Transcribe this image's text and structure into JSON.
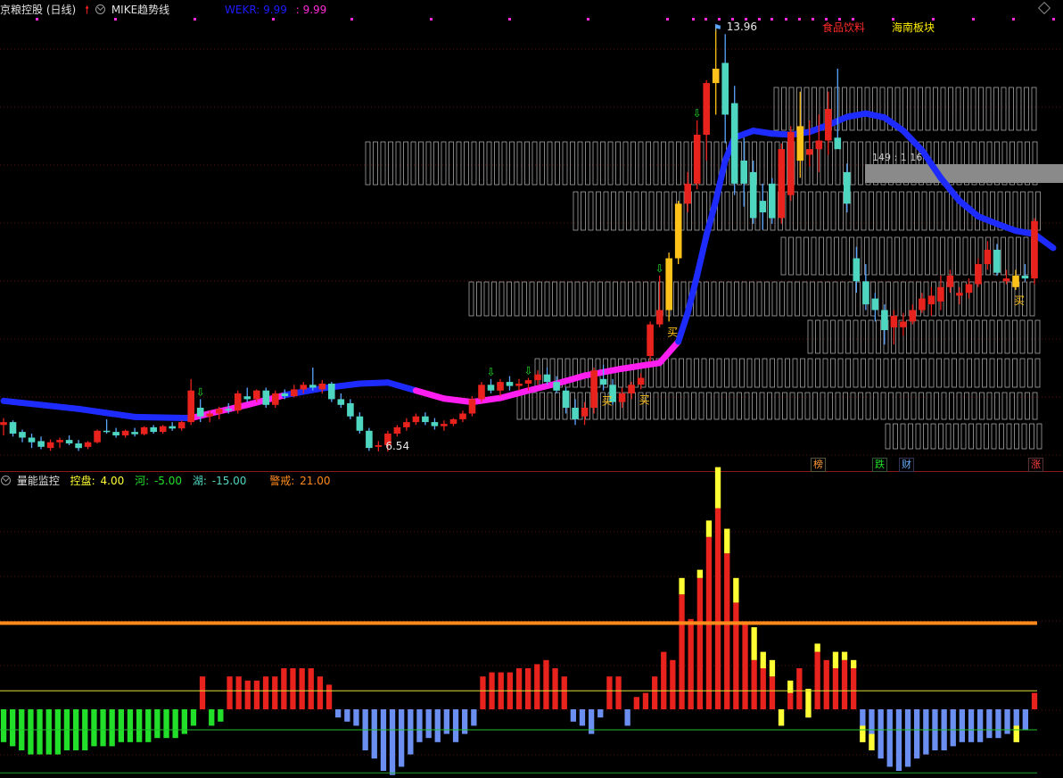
{
  "top_header": {
    "stock": "京粮控股 (日线)",
    "indicator": "MIKE趋势线",
    "wekr_label": "WEKR: 9.99",
    "wekr_value": ": 9.99"
  },
  "sector_tags": {
    "food": "食品饮料",
    "hainan": "海南板块"
  },
  "bottom_header": {
    "name": "量能监控",
    "kongpan_label": "控盘:",
    "kongpan_value": "4.00",
    "he_label": "河:",
    "he_value": "-5.00",
    "hu_label": "湖:",
    "hu_value": "-15.00",
    "jingjie_label": "警戒:",
    "jingjie_value": "21.00"
  },
  "badges": [
    "榜",
    "跌",
    "财",
    "涨"
  ],
  "colors": {
    "up": "#e8221c",
    "down": "#4fd6c1",
    "gold": "#ffc21a",
    "blue_line": "#1e2bff",
    "magenta_line": "#ff1ef0",
    "orange_line": "#ff8a1c",
    "green_bar": "#22e02a",
    "blue_bar": "#6b8ff0",
    "yellow_bar": "#ffff33"
  },
  "chart_data": [
    {
      "type": "candlestick",
      "title": "京粮控股 (日线)",
      "annotations": {
        "high": "13.96",
        "low": "6.54",
        "box_label": "149 : 1 16",
        "buy": "买"
      },
      "candles": [
        [
          7.0,
          7.12,
          6.82,
          7.05
        ],
        [
          7.05,
          7.08,
          6.8,
          6.85
        ],
        [
          6.88,
          6.92,
          6.7,
          6.78
        ],
        [
          6.78,
          6.85,
          6.6,
          6.7
        ],
        [
          6.72,
          6.8,
          6.58,
          6.62
        ],
        [
          6.6,
          6.75,
          6.55,
          6.7
        ],
        [
          6.7,
          6.78,
          6.6,
          6.74
        ],
        [
          6.74,
          6.82,
          6.65,
          6.68
        ],
        [
          6.68,
          6.74,
          6.55,
          6.6
        ],
        [
          6.62,
          6.72,
          6.58,
          6.7
        ],
        [
          6.7,
          6.92,
          6.68,
          6.9
        ],
        [
          6.9,
          7.1,
          6.85,
          6.88
        ],
        [
          6.88,
          6.95,
          6.78,
          6.82
        ],
        [
          6.82,
          6.92,
          6.78,
          6.9
        ],
        [
          6.88,
          6.95,
          6.8,
          6.84
        ],
        [
          6.84,
          6.98,
          6.82,
          6.96
        ],
        [
          6.96,
          7.0,
          6.85,
          6.88
        ],
        [
          6.88,
          7.0,
          6.85,
          6.98
        ],
        [
          6.98,
          7.05,
          6.9,
          6.94
        ],
        [
          6.94,
          7.08,
          6.9,
          7.05
        ],
        [
          7.05,
          7.8,
          7.0,
          7.6
        ],
        [
          7.3,
          7.45,
          7.05,
          7.15
        ],
        [
          7.15,
          7.25,
          7.05,
          7.2
        ],
        [
          7.2,
          7.32,
          7.1,
          7.28
        ],
        [
          7.28,
          7.38,
          7.2,
          7.25
        ],
        [
          7.25,
          7.6,
          7.2,
          7.55
        ],
        [
          7.5,
          7.65,
          7.4,
          7.45
        ],
        [
          7.45,
          7.62,
          7.4,
          7.6
        ],
        [
          7.6,
          7.65,
          7.3,
          7.35
        ],
        [
          7.35,
          7.6,
          7.3,
          7.55
        ],
        [
          7.55,
          7.62,
          7.45,
          7.5
        ],
        [
          7.5,
          7.7,
          7.48,
          7.62
        ],
        [
          7.62,
          7.75,
          7.55,
          7.7
        ],
        [
          7.7,
          8.0,
          7.6,
          7.65
        ],
        [
          7.62,
          7.78,
          7.55,
          7.72
        ],
        [
          7.72,
          7.75,
          7.4,
          7.45
        ],
        [
          7.45,
          7.55,
          7.3,
          7.35
        ],
        [
          7.38,
          7.45,
          7.1,
          7.15
        ],
        [
          7.15,
          7.22,
          6.85,
          6.9
        ],
        [
          6.9,
          6.95,
          6.55,
          6.6
        ],
        [
          6.62,
          6.72,
          6.54,
          6.65
        ],
        [
          6.65,
          6.9,
          6.54,
          6.85
        ],
        [
          6.85,
          7.0,
          6.8,
          6.96
        ],
        [
          6.96,
          7.12,
          6.9,
          7.05
        ],
        [
          7.05,
          7.2,
          7.0,
          7.15
        ],
        [
          7.15,
          7.22,
          7.0,
          7.05
        ],
        [
          7.05,
          7.12,
          6.92,
          6.98
        ],
        [
          6.98,
          7.08,
          6.9,
          7.02
        ],
        [
          7.02,
          7.12,
          6.98,
          7.1
        ],
        [
          7.1,
          7.25,
          7.05,
          7.2
        ],
        [
          7.2,
          7.5,
          7.15,
          7.45
        ],
        [
          7.45,
          7.75,
          7.4,
          7.7
        ],
        [
          7.7,
          7.8,
          7.55,
          7.6
        ],
        [
          7.6,
          7.8,
          7.5,
          7.75
        ],
        [
          7.75,
          7.85,
          7.6,
          7.68
        ],
        [
          7.68,
          7.8,
          7.6,
          7.72
        ],
        [
          7.72,
          7.82,
          7.6,
          7.78
        ],
        [
          7.78,
          7.95,
          7.7,
          7.88
        ],
        [
          7.88,
          8.0,
          7.7,
          7.75
        ],
        [
          7.75,
          7.85,
          7.55,
          7.6
        ],
        [
          7.6,
          7.65,
          7.2,
          7.3
        ],
        [
          7.3,
          7.45,
          7.0,
          7.1
        ],
        [
          7.15,
          7.4,
          7.0,
          7.3
        ],
        [
          7.3,
          8.0,
          7.2,
          7.95
        ],
        [
          7.8,
          8.05,
          7.6,
          7.7
        ],
        [
          7.7,
          7.8,
          7.35,
          7.4
        ],
        [
          7.4,
          7.65,
          7.3,
          7.55
        ],
        [
          7.55,
          7.75,
          7.45,
          7.7
        ],
        [
          7.7,
          7.9,
          7.62,
          7.82
        ],
        [
          8.2,
          8.8,
          8.1,
          8.75
        ],
        [
          8.75,
          9.6,
          8.7,
          9.0
        ],
        [
          9.0,
          10.0,
          8.8,
          9.9
        ],
        [
          9.9,
          10.9,
          9.8,
          10.85
        ],
        [
          10.85,
          11.4,
          10.7,
          11.2
        ],
        [
          11.2,
          12.3,
          11.1,
          12.05
        ],
        [
          12.05,
          13.0,
          11.6,
          12.95
        ],
        [
          12.95,
          13.96,
          12.4,
          13.2
        ],
        [
          13.3,
          13.8,
          11.9,
          12.4
        ],
        [
          12.6,
          12.9,
          11.0,
          11.2
        ],
        [
          11.6,
          12.0,
          10.8,
          11.2
        ],
        [
          11.4,
          11.6,
          10.5,
          10.6
        ],
        [
          10.9,
          11.2,
          10.4,
          10.7
        ],
        [
          11.2,
          11.3,
          10.5,
          10.6
        ],
        [
          10.6,
          11.9,
          10.5,
          11.8
        ],
        [
          11.0,
          12.2,
          10.9,
          12.1
        ],
        [
          12.2,
          12.8,
          11.3,
          11.6
        ],
        [
          11.7,
          12.3,
          11.5,
          11.8
        ],
        [
          11.8,
          12.4,
          11.4,
          11.95
        ],
        [
          11.95,
          12.8,
          11.7,
          12.5
        ],
        [
          12.0,
          13.2,
          11.9,
          11.8
        ],
        [
          11.4,
          11.55,
          10.7,
          10.85
        ],
        [
          9.9,
          10.1,
          9.3,
          9.5
        ],
        [
          9.5,
          9.8,
          9.0,
          9.1
        ],
        [
          9.2,
          9.3,
          8.8,
          9.0
        ],
        [
          9.0,
          9.1,
          8.4,
          8.65
        ],
        [
          8.7,
          9.0,
          8.4,
          8.9
        ],
        [
          8.7,
          8.95,
          8.55,
          8.8
        ],
        [
          8.8,
          9.1,
          8.75,
          9.0
        ],
        [
          9.0,
          9.3,
          8.95,
          9.2
        ],
        [
          9.1,
          9.4,
          8.9,
          9.25
        ],
        [
          9.15,
          9.6,
          9.0,
          9.4
        ],
        [
          9.4,
          9.7,
          9.3,
          9.6
        ],
        [
          9.25,
          9.4,
          9.1,
          9.3
        ],
        [
          9.3,
          9.55,
          9.2,
          9.45
        ],
        [
          9.45,
          9.9,
          9.4,
          9.8
        ],
        [
          9.8,
          10.2,
          9.7,
          10.05
        ],
        [
          10.05,
          10.15,
          9.6,
          9.65
        ],
        [
          9.5,
          9.7,
          9.45,
          9.55
        ],
        [
          9.4,
          9.7,
          9.35,
          9.6
        ],
        [
          9.6,
          9.8,
          9.5,
          9.55
        ],
        [
          9.55,
          10.6,
          9.45,
          10.55
        ]
      ],
      "mike_line": [
        [
          0,
          7.42
        ],
        [
          8,
          7.28
        ],
        [
          14,
          7.14
        ],
        [
          20,
          7.12
        ],
        [
          22,
          7.2
        ],
        [
          26,
          7.35
        ],
        [
          30,
          7.52
        ],
        [
          34,
          7.64
        ],
        [
          38,
          7.72
        ],
        [
          41,
          7.74
        ],
        [
          44,
          7.6
        ],
        [
          47,
          7.46
        ],
        [
          50,
          7.4
        ],
        [
          53,
          7.47
        ],
        [
          56,
          7.6
        ],
        [
          59,
          7.72
        ],
        [
          62,
          7.86
        ],
        [
          66,
          7.98
        ],
        [
          68,
          8.03
        ],
        [
          70,
          8.08
        ],
        [
          72,
          8.45
        ],
        [
          73,
          8.95
        ],
        [
          74,
          9.6
        ],
        [
          75,
          10.3
        ],
        [
          76,
          10.9
        ],
        [
          77,
          11.6
        ],
        [
          78,
          12.0
        ],
        [
          80,
          12.12
        ],
        [
          82,
          12.07
        ],
        [
          84,
          12.05
        ],
        [
          86,
          12.1
        ],
        [
          88,
          12.22
        ],
        [
          90,
          12.36
        ],
        [
          92,
          12.42
        ],
        [
          94,
          12.35
        ],
        [
          96,
          12.12
        ],
        [
          98,
          11.78
        ],
        [
          100,
          11.3
        ],
        [
          102,
          10.9
        ],
        [
          104,
          10.63
        ],
        [
          106,
          10.5
        ],
        [
          108,
          10.38
        ],
        [
          110,
          10.32
        ],
        [
          112,
          10.08
        ]
      ],
      "mike_bull_range": [
        [
          20,
          30
        ],
        [
          44,
          72
        ]
      ]
    },
    {
      "type": "bar",
      "title": "量能监控",
      "series": [
        {
          "name": "控盘",
          "values": [
            4.0
          ]
        },
        {
          "name": "河",
          "values": [
            -5.0
          ]
        },
        {
          "name": "湖",
          "values": [
            -15.0
          ]
        },
        {
          "name": "警戒",
          "values": [
            21.0
          ]
        }
      ],
      "bars": [
        -8,
        -9,
        -10,
        -11,
        -11,
        -11,
        -11,
        -10,
        -10,
        -10,
        -9,
        -9,
        -9,
        -8,
        -8,
        -8,
        -8,
        -7,
        -7,
        -7,
        -6,
        -4,
        8,
        -4,
        -3,
        8,
        8,
        7,
        7,
        8,
        8,
        10,
        10,
        10,
        10,
        8,
        6,
        -2,
        -3,
        -4,
        -10,
        -12,
        -15,
        -16,
        -14,
        -11,
        -8,
        -7,
        -8,
        -6,
        -8,
        -6,
        -4,
        8,
        9,
        9,
        9,
        10,
        10,
        11,
        12,
        10,
        8,
        -3,
        -4,
        -6,
        -2,
        8,
        8,
        -4,
        3,
        4,
        8,
        14,
        12,
        28,
        22,
        32,
        42,
        49,
        38,
        26,
        21,
        12,
        10,
        8,
        -4,
        4,
        10,
        -2,
        14,
        12,
        10,
        12,
        10,
        -8,
        -10,
        -12,
        -14,
        -15,
        -14,
        -12,
        -11,
        -10,
        -10,
        -9,
        -8,
        -8,
        -8,
        -7,
        -7,
        -6,
        -8,
        -5,
        4
      ],
      "yellow_caps": {
        "75": 4,
        "77": 2,
        "78": 4,
        "79": 10,
        "80": 6,
        "81": 6,
        "83": 8,
        "84": 4,
        "85": 4,
        "86": 4,
        "87": 3,
        "89": 7,
        "90": 2,
        "92": 4,
        "93": 2,
        "94": 2,
        "95": 4,
        "96": 4,
        "112": 4
      },
      "ylim": [
        -35,
        55
      ]
    }
  ]
}
